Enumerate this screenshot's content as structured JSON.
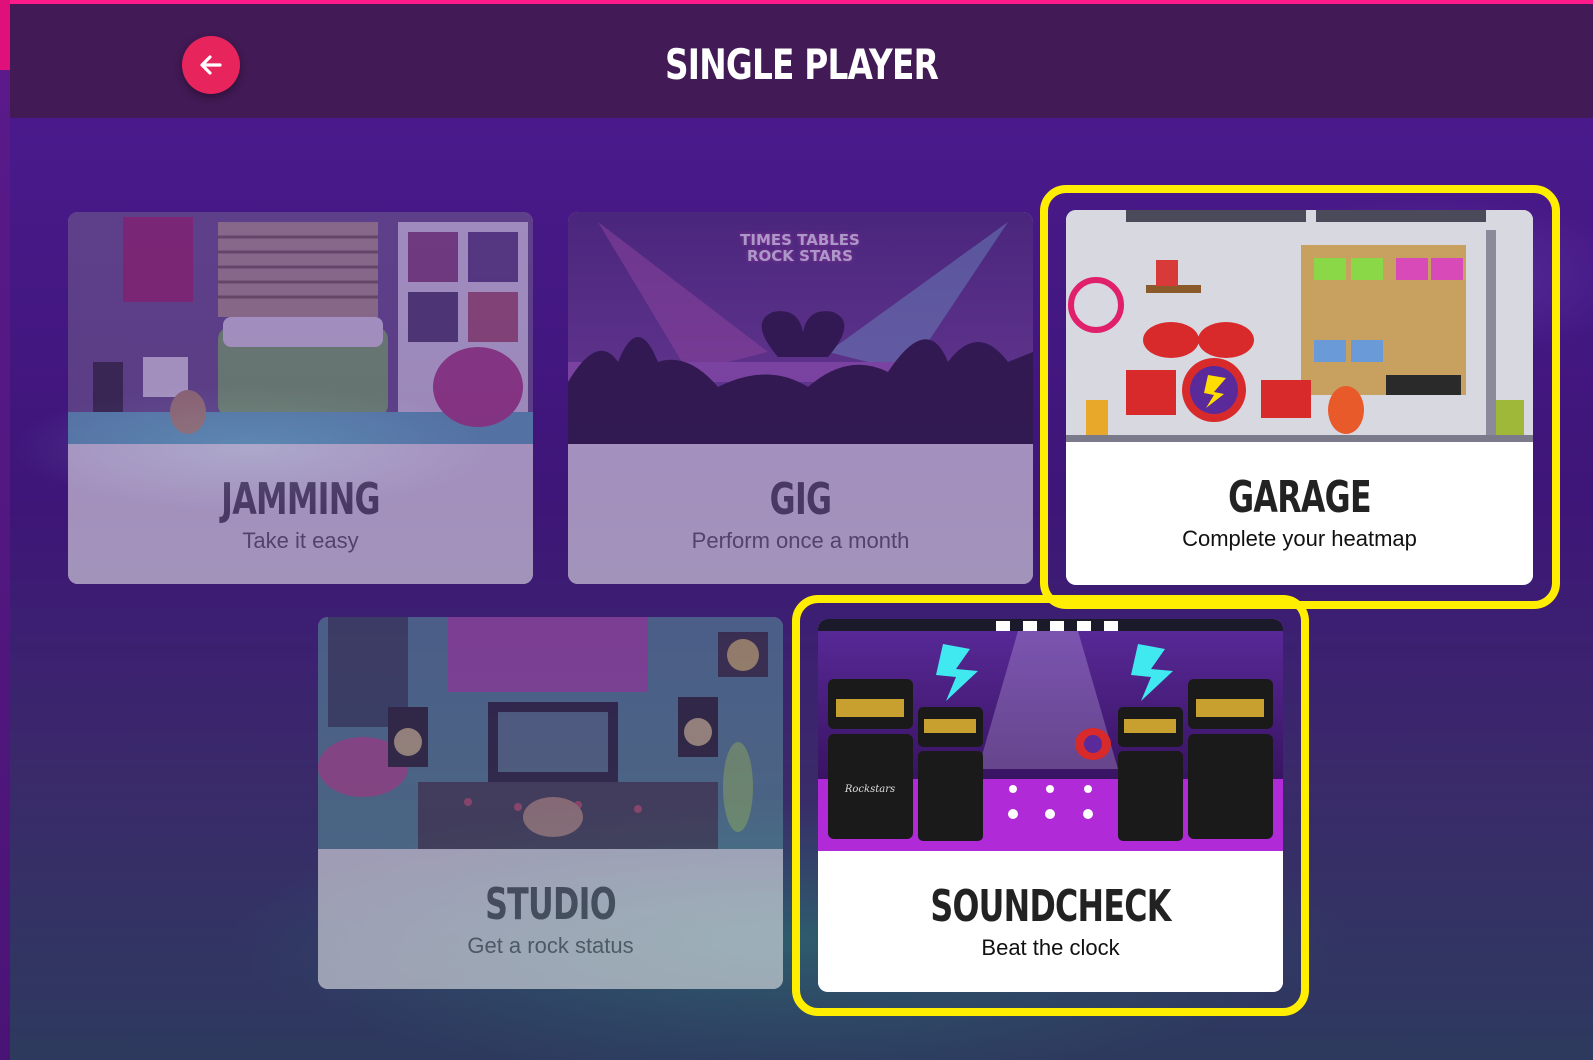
{
  "header": {
    "title": "SINGLE PLAYER",
    "back_icon": "arrow-left-icon"
  },
  "modes": [
    {
      "name": "JAMMING",
      "subtitle": "Take it easy",
      "state": "dimmed",
      "scene": "bedroom-illustration"
    },
    {
      "name": "GIG",
      "subtitle": "Perform once a month",
      "state": "dimmed",
      "scene": "concert-crowd-illustration",
      "logo_text": "TIMES TABLES ROCK STARS"
    },
    {
      "name": "GARAGE",
      "subtitle": "Complete your heatmap",
      "state": "highlighted",
      "scene": "garage-illustration"
    },
    {
      "name": "STUDIO",
      "subtitle": "Get a rock status",
      "state": "dimmed",
      "scene": "recording-studio-illustration"
    },
    {
      "name": "SOUNDCHECK",
      "subtitle": "Beat the clock",
      "state": "highlighted",
      "scene": "stage-amps-illustration",
      "amp_brand_text": "Rockstars"
    }
  ],
  "colors": {
    "accent": "#e8245c",
    "highlight": "#ffee00",
    "header_bg": "#421a55"
  }
}
